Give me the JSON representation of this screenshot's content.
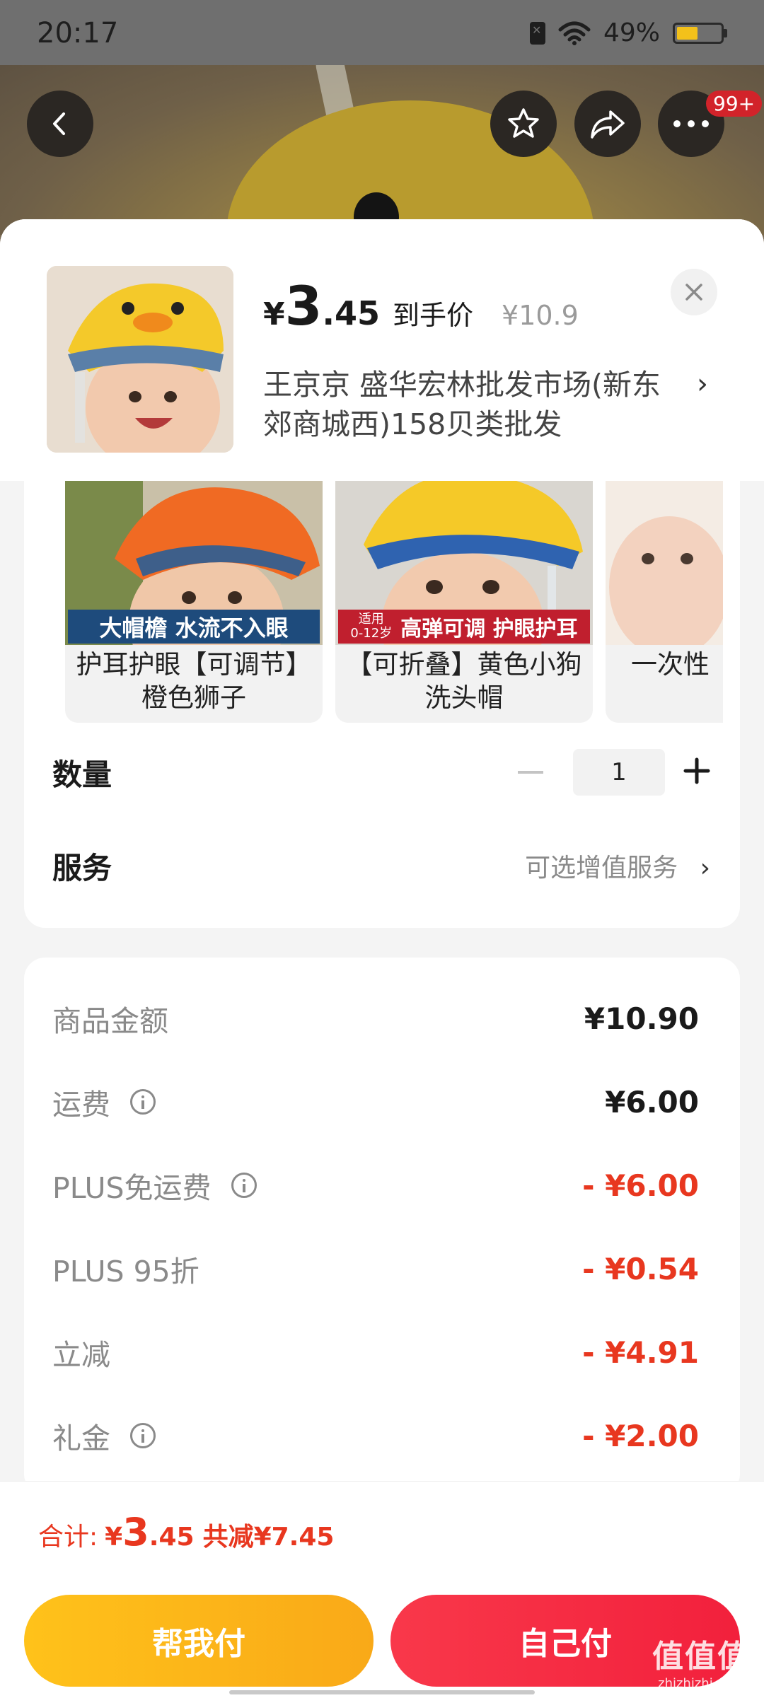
{
  "status_bar": {
    "time": "20:17",
    "battery": "49%",
    "battery_level": 0.49
  },
  "header": {
    "badge": "99+",
    "icons": [
      "back-icon",
      "star-icon",
      "share-icon",
      "more-icon"
    ]
  },
  "product": {
    "price_currency": "¥",
    "price_int": "3",
    "price_dec": ".45",
    "price_tag": "到手价",
    "original_price": "¥10.9",
    "shop_name": "王京京  盛华宏林批发市场(新东郊商城西)158贝类批发",
    "shop_arrow": "›"
  },
  "variants": [
    {
      "banner": "大帽檐 水流不入眼",
      "name": "护耳护眼【可调节】橙色狮子"
    },
    {
      "banner_age": "适用\n0-12岁",
      "banner": "高弹可调 护眼护耳",
      "name": "【可折叠】黄色小狗洗头帽"
    },
    {
      "banner": "",
      "name": "一次性"
    }
  ],
  "quantity": {
    "label": "数量",
    "value": "1"
  },
  "service": {
    "label": "服务",
    "value": "可选增值服务",
    "arrow": "›"
  },
  "fees": [
    {
      "label": "商品金额",
      "value": "¥10.90",
      "info": false,
      "red": false
    },
    {
      "label": "运费",
      "value": "¥6.00",
      "info": true,
      "red": false
    },
    {
      "label": "PLUS免运费",
      "value": "- ¥6.00",
      "info": true,
      "red": true
    },
    {
      "label": "PLUS 95折",
      "value": "- ¥0.54",
      "info": false,
      "red": true
    },
    {
      "label": "立减",
      "value": "- ¥4.91",
      "info": false,
      "red": true
    },
    {
      "label": "礼金",
      "value": "- ¥2.00",
      "info": true,
      "red": true
    }
  ],
  "footer": {
    "total_label": "合计:",
    "total_currency": "¥",
    "total_int": "3",
    "total_dec": ".45",
    "savings": "共减¥7.45",
    "btn_help": "帮我付",
    "btn_self": "自己付"
  },
  "watermark": {
    "main": "值值值",
    "sub": "zhizhizhi.com"
  },
  "colors": {
    "accent_red": "#e8371f",
    "button_yellow": "#ffc21a",
    "button_red": "#f2203c",
    "badge_red": "#d2232a"
  }
}
